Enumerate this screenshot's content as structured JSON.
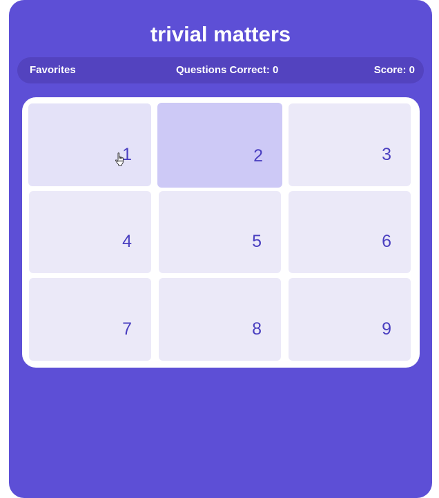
{
  "header": {
    "title": "trivial matters"
  },
  "status": {
    "favorites_label": "Favorites",
    "questions_correct": "Questions Correct: 0",
    "score": "Score: 0"
  },
  "board": {
    "tiles": [
      {
        "label": "1"
      },
      {
        "label": "2"
      },
      {
        "label": "3"
      },
      {
        "label": "4"
      },
      {
        "label": "5"
      },
      {
        "label": "6"
      },
      {
        "label": "7"
      },
      {
        "label": "8"
      },
      {
        "label": "9"
      }
    ]
  },
  "colors": {
    "background": "#5d4fd6",
    "status_bar": "#5343bf",
    "tile": "#ebe9f8",
    "tile_hover": "#cdc9f6",
    "tile_number": "#4a3fc0"
  },
  "icons": {
    "cursor": "hand-pointer-icon"
  }
}
